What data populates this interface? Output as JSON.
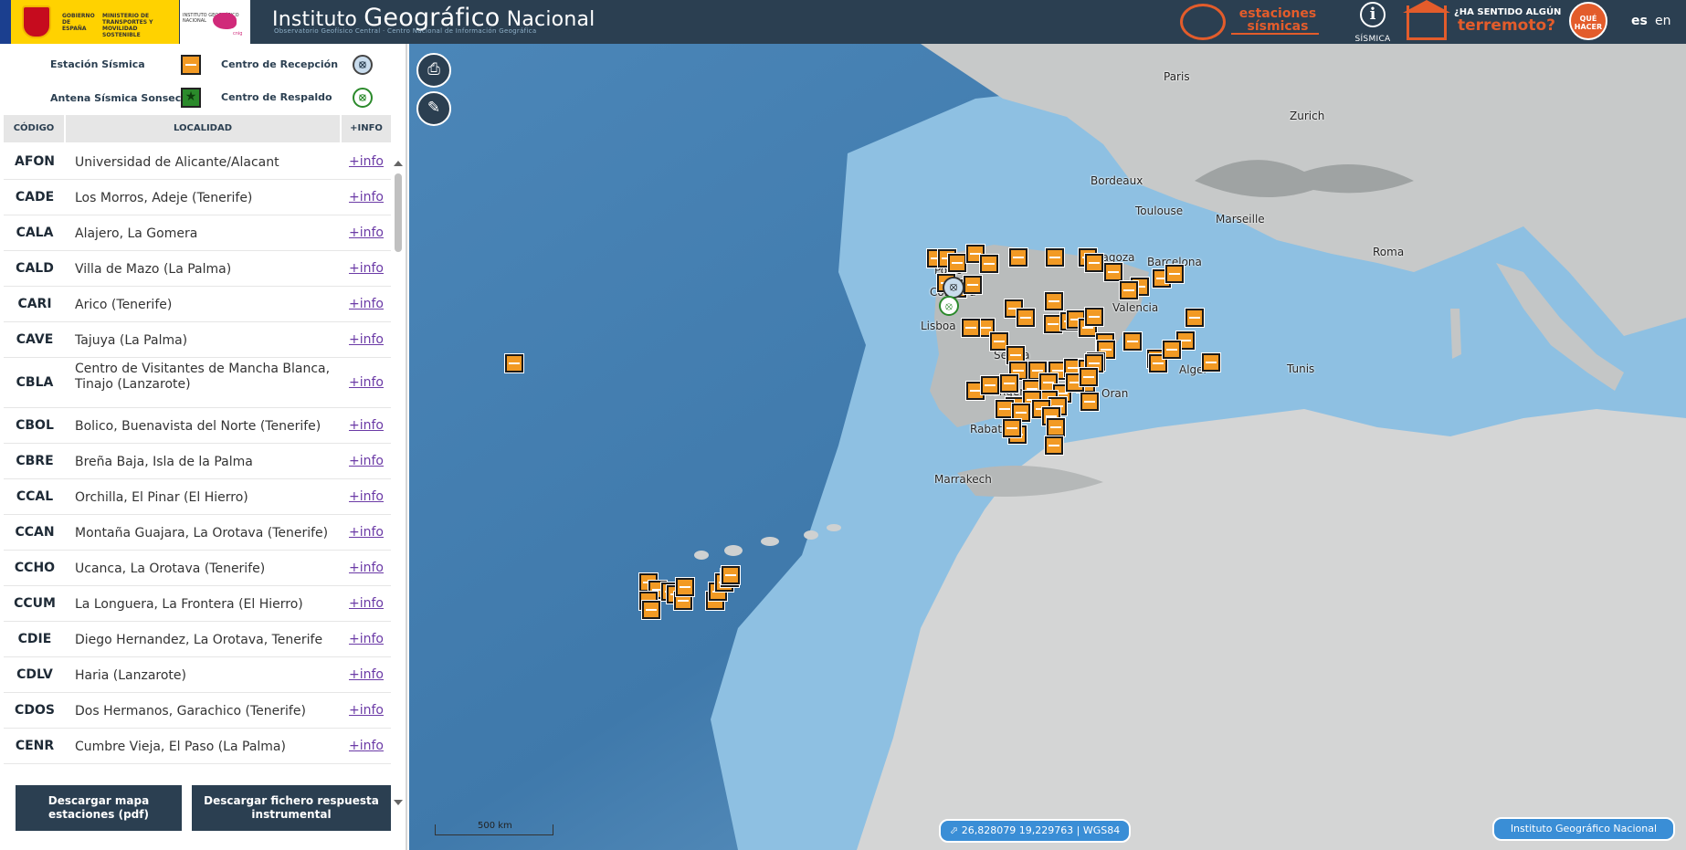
{
  "header": {
    "gov_text": "GOBIERNO DE ESPAÑA",
    "ministry_text": "MINISTERIO DE TRANSPORTES Y MOVILIDAD SOSTENIBLE",
    "ign_small_text": "INSTITUTO GEOGRÁFICO NACIONAL",
    "cnig_text": "cnig",
    "title_prefix": "Instituto",
    "title_main": "Geográfico",
    "title_suffix": "Nacional",
    "subtitle": "Observatorio Geofísico Central · Centro Nacional de Información Geográfica",
    "estaciones_label": "estaciones sísmicas",
    "info_label": "SÍSMICA",
    "sentido_top": "¿HA SENTIDO ALGÚN",
    "sentido_bottom": "terremoto?",
    "que_hacer": "QUÉ HACER",
    "lang_es": "es",
    "lang_en": "en"
  },
  "legend": {
    "seismic_station": "Estación Sísmica",
    "reception_center": "Centro de Recepción",
    "antenna": "Antena Sísmica Sonseca",
    "backup_center": "Centro de Respaldo"
  },
  "table": {
    "headers": [
      "CÓDIGO",
      "LOCALIDAD",
      "+INFO"
    ],
    "rows": [
      {
        "code": "AFON",
        "loc": "Universidad de Alicante/Alacant",
        "info": "+info"
      },
      {
        "code": "CADE",
        "loc": "Los Morros, Adeje (Tenerife)",
        "info": "+info"
      },
      {
        "code": "CALA",
        "loc": "Alajero, La Gomera",
        "info": "+info"
      },
      {
        "code": "CALD",
        "loc": "Villa de Mazo (La Palma)",
        "info": "+info"
      },
      {
        "code": "CARI",
        "loc": "Arico (Tenerife)",
        "info": "+info"
      },
      {
        "code": "CAVE",
        "loc": "Tajuya (La Palma)",
        "info": "+info"
      },
      {
        "code": "CBLA",
        "loc": "Centro de Visitantes de Mancha Blanca, Tinajo (Lanzarote)",
        "info": "+info"
      },
      {
        "code": "CBOL",
        "loc": "Bolico, Buenavista del Norte (Tenerife)",
        "info": "+info"
      },
      {
        "code": "CBRE",
        "loc": "Breña Baja, Isla de la Palma",
        "info": "+info"
      },
      {
        "code": "CCAL",
        "loc": "Orchilla, El Pinar (El Hierro)",
        "info": "+info"
      },
      {
        "code": "CCAN",
        "loc": "Montaña Guajara, La Orotava (Tenerife)",
        "info": "+info"
      },
      {
        "code": "CCHO",
        "loc": "Ucanca, La Orotava (Tenerife)",
        "info": "+info"
      },
      {
        "code": "CCUM",
        "loc": "La Longuera, La Frontera (El Hierro)",
        "info": "+info"
      },
      {
        "code": "CDIE",
        "loc": "Diego Hernandez, La Orotava, Tenerife",
        "info": "+info"
      },
      {
        "code": "CDLV",
        "loc": "Haria (Lanzarote)",
        "info": "+info"
      },
      {
        "code": "CDOS",
        "loc": "Dos Hermanos, Garachico (Tenerife)",
        "info": "+info"
      },
      {
        "code": "CENR",
        "loc": "Cumbre Vieja, El Paso (La Palma)",
        "info": "+info"
      }
    ]
  },
  "buttons": {
    "download_map": "Descargar mapa estaciones (pdf)",
    "download_response": "Descargar fichero respuesta instrumental"
  },
  "map": {
    "cities": [
      "Paris",
      "Zurich",
      "Bordeaux",
      "Toulouse",
      "Marseille",
      "Roma",
      "Porto",
      "Coimbra",
      "Lisboa",
      "Zaragoza",
      "Barcelona",
      "Valencia",
      "Sevilla",
      "Tanger",
      "Oran",
      "Alger",
      "Tunis",
      "Rabat",
      "Marrakech"
    ],
    "coord_label": "26,828079   19,229763 | WGS84",
    "scale_label": "500 km",
    "attribution": "Instituto Geográfico Nacional"
  }
}
